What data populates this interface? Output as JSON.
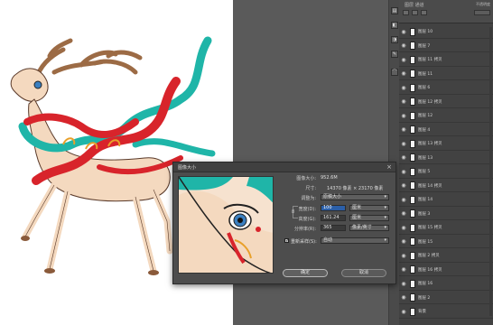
{
  "dialog": {
    "title": "图像大小",
    "close_glyph": "×",
    "image_size_label": "图像大小:",
    "image_size_value": "952.6M",
    "dimensions_label": "尺寸:",
    "dimensions_value": "14370 像素 × 23170 像素",
    "fit_label": "调整为:",
    "fit_value": "原稿大小",
    "width_label": "宽度(D):",
    "width_value": "100",
    "width_unit": "厘米",
    "height_label": "高度(G):",
    "height_value": "161.24",
    "height_unit": "厘米",
    "resolution_label": "分辨率(R):",
    "resolution_value": "365",
    "resolution_unit": "像素/英寸",
    "resample_label": "重新采样(S):",
    "resample_value": "自动",
    "resample_checked": "✓",
    "chain_glyph": "8",
    "ok_label": "确定",
    "cancel_label": "取消"
  },
  "layers_panel": {
    "tab_label": "图层 通道",
    "opacity_label": "不透明度",
    "eye_glyph": "◉",
    "layers": [
      "图层 10",
      "图层 7",
      "图层 11 拷贝",
      "图层 11",
      "图层 6",
      "图层 12 拷贝",
      "图层 12",
      "图层 4",
      "图层 13 拷贝",
      "图层 13",
      "图层 5",
      "图层 14 拷贝",
      "图层 14",
      "图层 3",
      "图层 15 拷贝",
      "图层 15",
      "图层 2 拷贝",
      "图层 16 拷贝",
      "图层 16",
      "图层 2",
      "背景"
    ]
  },
  "colors": {
    "teal_ribbon": "#1fb5a8",
    "red_ribbon": "#d8242b",
    "deer_body": "#f4d9bf",
    "antler": "#9c6b45",
    "dialog_bg": "#4d4d4d",
    "selection_blue": "#2b5fa8"
  }
}
